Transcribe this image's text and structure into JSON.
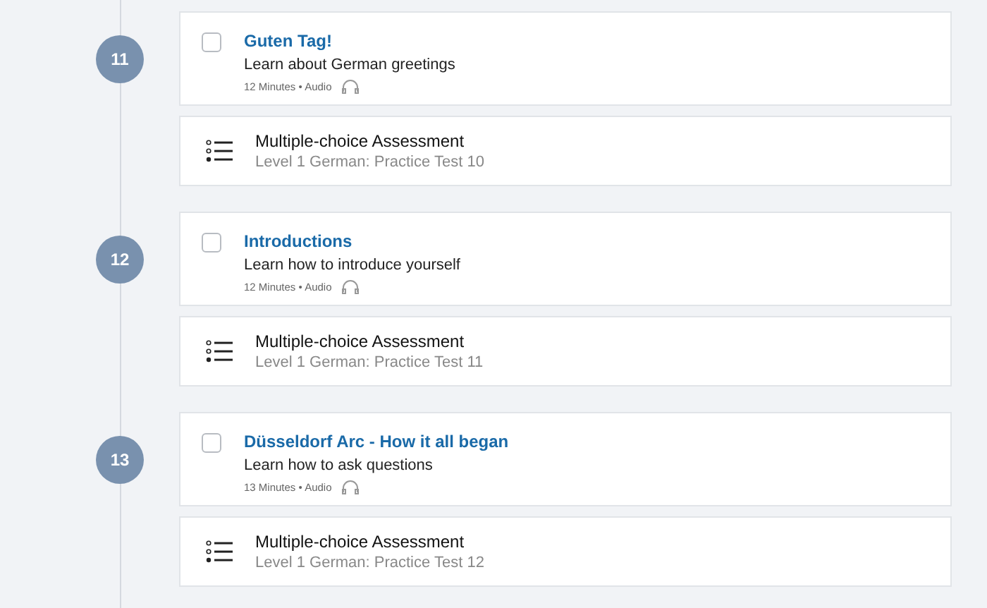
{
  "units": [
    {
      "number": "11",
      "lesson": {
        "title": "Guten Tag!",
        "description": "Learn about German greetings",
        "meta": "12 Minutes • Audio",
        "checked": false
      },
      "assessment": {
        "title": "Multiple-choice Assessment",
        "subtitle": "Level 1 German: Practice Test 10"
      }
    },
    {
      "number": "12",
      "lesson": {
        "title": "Introductions",
        "description": "Learn how to introduce yourself",
        "meta": "12 Minutes • Audio",
        "checked": false
      },
      "assessment": {
        "title": "Multiple-choice Assessment",
        "subtitle": "Level 1 German: Practice Test 11"
      }
    },
    {
      "number": "13",
      "lesson": {
        "title": "Düsseldorf Arc - How it all began",
        "description": "Learn how to ask questions",
        "meta": "13 Minutes • Audio",
        "checked": false
      },
      "assessment": {
        "title": "Multiple-choice Assessment",
        "subtitle": "Level 1 German: Practice Test 12"
      }
    }
  ]
}
